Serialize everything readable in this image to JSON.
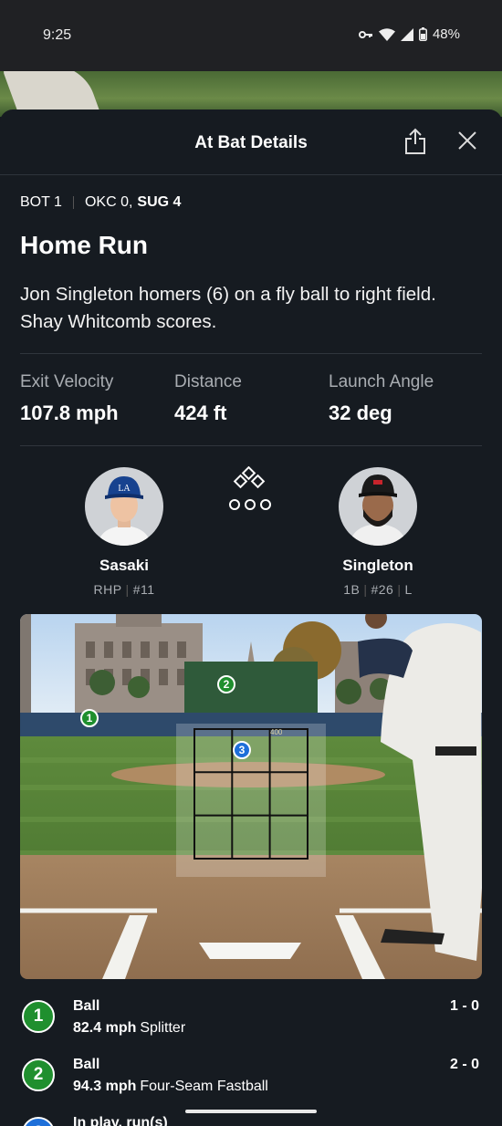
{
  "status": {
    "time": "9:25",
    "battery": "48%"
  },
  "header": {
    "title": "At Bat Details"
  },
  "inning": {
    "half": "BOT 1",
    "away": "OKC 0,",
    "home": "SUG 4"
  },
  "play": {
    "title": "Home Run",
    "description": "Jon Singleton homers (6) on a fly ball to right field. Shay Whitcomb scores."
  },
  "stats": [
    {
      "label": "Exit Velocity",
      "value": "107.8 mph"
    },
    {
      "label": "Distance",
      "value": "424 ft"
    },
    {
      "label": "Launch Angle",
      "value": "32 deg"
    }
  ],
  "pitcher": {
    "name": "Sasaki",
    "throws": "RHP",
    "number": "#11"
  },
  "batter": {
    "name": "Singleton",
    "position": "1B",
    "number": "#26",
    "bats": "L"
  },
  "field": {
    "markers": [
      "1",
      "2",
      "3"
    ],
    "zone_label": "400"
  },
  "pitches": [
    {
      "num": "1",
      "result": "Ball",
      "speed": "82.4 mph",
      "type": "Splitter",
      "count": "1 - 0",
      "color": "#1f8f2e"
    },
    {
      "num": "2",
      "result": "Ball",
      "speed": "94.3 mph",
      "type": "Four-Seam Fastball",
      "count": "2 - 0",
      "color": "#1f8f2e"
    },
    {
      "num": "3",
      "result": "In play, run(s)",
      "speed": "",
      "type": "",
      "count": "",
      "color": "#1e6fd9"
    }
  ],
  "colors": {
    "ball": "#1f8f2e",
    "in_play": "#1e6fd9",
    "background": "#161b21"
  }
}
